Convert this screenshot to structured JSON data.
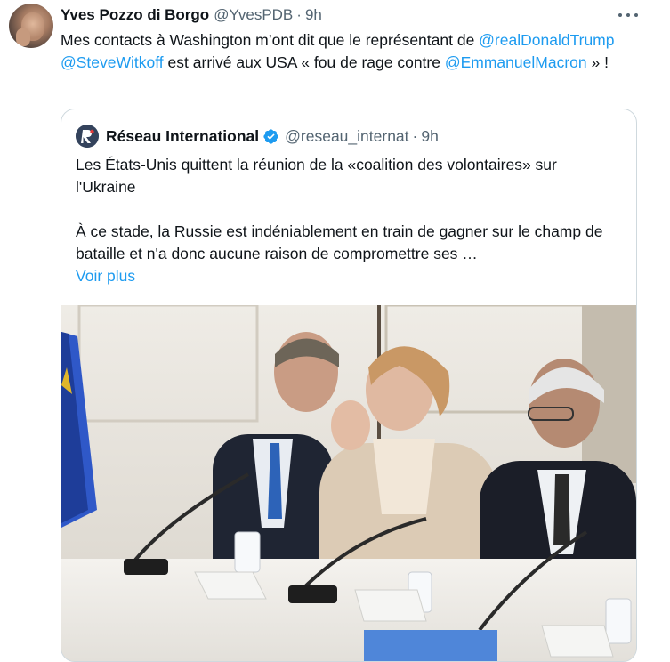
{
  "tweet": {
    "author_name": "Yves Pozzo di Borgo",
    "author_handle": "@YvesPDB",
    "separator": "·",
    "time": "9h",
    "text_before": "Mes contacts à Washington m’ont dit que le représentant de ",
    "mention_1": "@realDonaldTrump",
    "space_1": " ",
    "mention_2": "@SteveWitkoff",
    "text_middle": " est arrivé aux USA « fou de rage contre ",
    "mention_3": "@EmmanuelMacron",
    "text_after": " » !"
  },
  "quote": {
    "author_name": "Réseau International",
    "author_handle": "@reseau_internat",
    "separator": "·",
    "time": "9h",
    "paragraph_1": "Les États-Unis quittent la réunion de la «coalition des volontaires» sur l'Ukraine",
    "paragraph_2": "À ce stade, la Russie est indéniablement en train de gagner sur le champ de bataille et n'a donc aucune raison de compromettre ses …",
    "see_more": "Voir plus"
  },
  "icons": {
    "more": "more-horizontal-icon",
    "verified": "verified-badge-icon"
  },
  "colors": {
    "link": "#1d9bf0",
    "muted": "#536471",
    "text": "#0f1419",
    "border": "#cfd9de"
  }
}
